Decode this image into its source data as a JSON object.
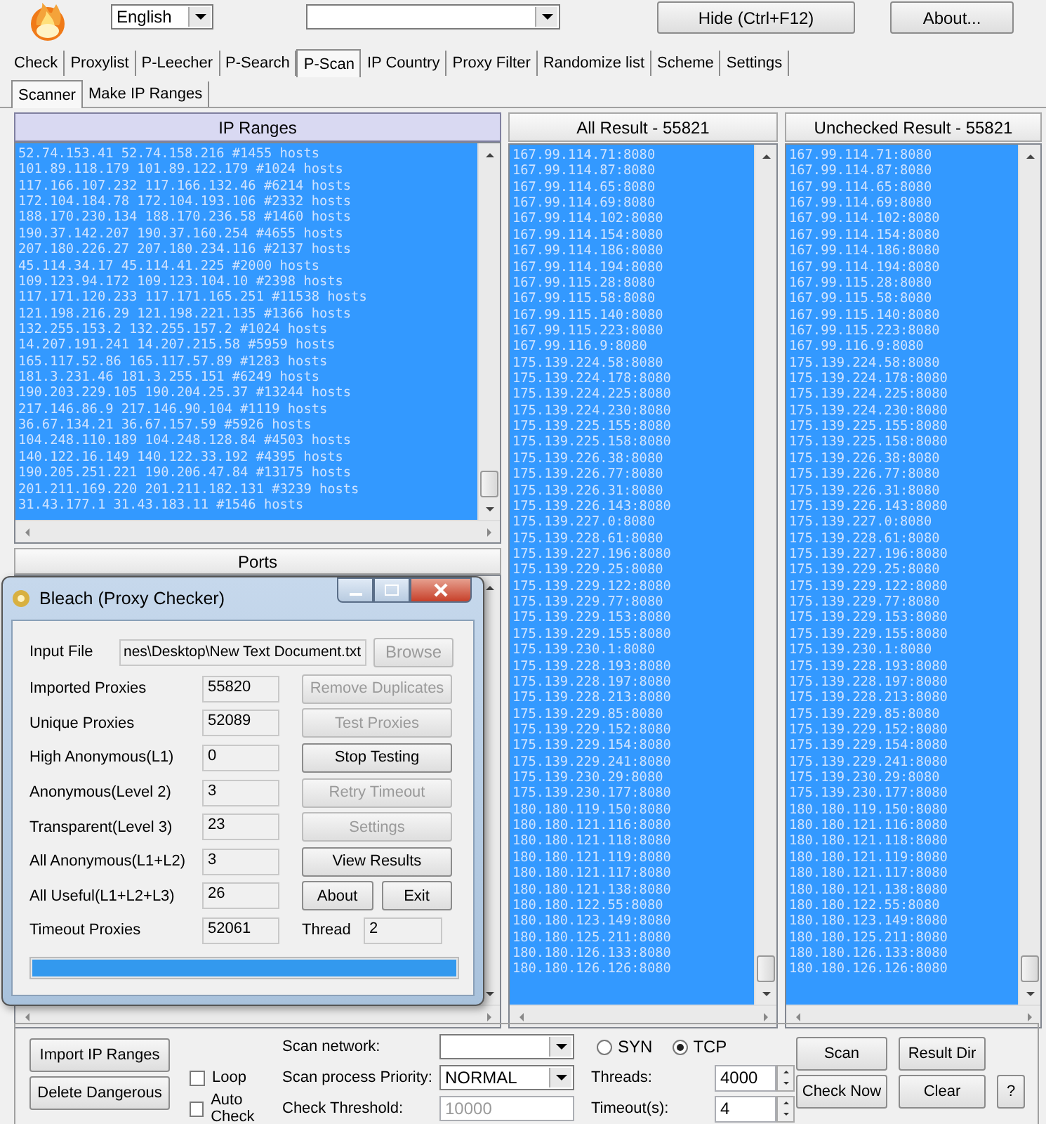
{
  "app": {
    "language": "English",
    "hide_button": "Hide (Ctrl+F12)",
    "about_button": "About..."
  },
  "tabs": [
    {
      "label": "Check",
      "selected": false
    },
    {
      "label": "Proxylist",
      "selected": false
    },
    {
      "label": "P-Leecher",
      "selected": false
    },
    {
      "label": "P-Search",
      "selected": false
    },
    {
      "label": "P-Scan",
      "selected": true
    },
    {
      "label": "IP Country",
      "selected": false
    },
    {
      "label": "Proxy Filter",
      "selected": false
    },
    {
      "label": "Randomize list",
      "selected": false
    },
    {
      "label": "Scheme",
      "selected": false
    },
    {
      "label": "Settings",
      "selected": false
    }
  ],
  "subtabs": [
    {
      "label": "Scanner",
      "selected": true
    },
    {
      "label": "Make IP Ranges",
      "selected": false
    }
  ],
  "ip_ranges": {
    "header": "IP Ranges",
    "rows": [
      "52.74.153.41 52.74.158.216 #1455 hosts",
      "101.89.118.179 101.89.122.179 #1024 hosts",
      "117.166.107.232 117.166.132.46 #6214 hosts",
      "172.104.184.78 172.104.193.106 #2332 hosts",
      "188.170.230.134 188.170.236.58 #1460 hosts",
      "190.37.142.207 190.37.160.254 #4655 hosts",
      "207.180.226.27 207.180.234.116 #2137 hosts",
      "45.114.34.17 45.114.41.225 #2000 hosts",
      "109.123.94.172 109.123.104.10 #2398 hosts",
      "117.171.120.233 117.171.165.251 #11538 hosts",
      "121.198.216.29 121.198.221.135 #1366 hosts",
      "132.255.153.2 132.255.157.2 #1024 hosts",
      "14.207.191.241 14.207.215.58 #5959 hosts",
      "165.117.52.86 165.117.57.89 #1283 hosts",
      "181.3.231.46 181.3.255.151 #6249 hosts",
      "190.203.229.105 190.204.25.37 #13244 hosts",
      "217.146.86.9 217.146.90.104 #1119 hosts",
      "36.67.134.21 36.67.157.59 #5926 hosts",
      "104.248.110.189 104.248.128.84 #4503 hosts",
      "140.122.16.149 140.122.33.192 #4395 hosts",
      "190.205.251.221 190.206.47.84 #13175 hosts",
      "201.211.169.220 201.211.182.131 #3239 hosts",
      "31.43.177.1 31.43.183.11 #1546 hosts"
    ]
  },
  "ports": {
    "header": "Ports"
  },
  "all_result": {
    "header": "All Result - 55821",
    "rows": [
      "167.99.114.71:8080",
      "167.99.114.87:8080",
      "167.99.114.65:8080",
      "167.99.114.69:8080",
      "167.99.114.102:8080",
      "167.99.114.154:8080",
      "167.99.114.186:8080",
      "167.99.114.194:8080",
      "167.99.115.28:8080",
      "167.99.115.58:8080",
      "167.99.115.140:8080",
      "167.99.115.223:8080",
      "167.99.116.9:8080",
      "175.139.224.58:8080",
      "175.139.224.178:8080",
      "175.139.224.225:8080",
      "175.139.224.230:8080",
      "175.139.225.155:8080",
      "175.139.225.158:8080",
      "175.139.226.38:8080",
      "175.139.226.77:8080",
      "175.139.226.31:8080",
      "175.139.226.143:8080",
      "175.139.227.0:8080",
      "175.139.228.61:8080",
      "175.139.227.196:8080",
      "175.139.229.25:8080",
      "175.139.229.122:8080",
      "175.139.229.77:8080",
      "175.139.229.153:8080",
      "175.139.229.155:8080",
      "175.139.230.1:8080",
      "175.139.228.193:8080",
      "175.139.228.197:8080",
      "175.139.228.213:8080",
      "175.139.229.85:8080",
      "175.139.229.152:8080",
      "175.139.229.154:8080",
      "175.139.229.241:8080",
      "175.139.230.29:8080",
      "175.139.230.177:8080",
      "180.180.119.150:8080",
      "180.180.121.116:8080",
      "180.180.121.118:8080",
      "180.180.121.119:8080",
      "180.180.121.117:8080",
      "180.180.121.138:8080",
      "180.180.122.55:8080",
      "180.180.123.149:8080",
      "180.180.125.211:8080",
      "180.180.126.133:8080",
      "180.180.126.126:8080"
    ]
  },
  "unchecked_result": {
    "header": "Unchecked Result - 55821",
    "rows": [
      "167.99.114.71:8080",
      "167.99.114.87:8080",
      "167.99.114.65:8080",
      "167.99.114.69:8080",
      "167.99.114.102:8080",
      "167.99.114.154:8080",
      "167.99.114.186:8080",
      "167.99.114.194:8080",
      "167.99.115.28:8080",
      "167.99.115.58:8080",
      "167.99.115.140:8080",
      "167.99.115.223:8080",
      "167.99.116.9:8080",
      "175.139.224.58:8080",
      "175.139.224.178:8080",
      "175.139.224.225:8080",
      "175.139.224.230:8080",
      "175.139.225.155:8080",
      "175.139.225.158:8080",
      "175.139.226.38:8080",
      "175.139.226.77:8080",
      "175.139.226.31:8080",
      "175.139.226.143:8080",
      "175.139.227.0:8080",
      "175.139.228.61:8080",
      "175.139.227.196:8080",
      "175.139.229.25:8080",
      "175.139.229.122:8080",
      "175.139.229.77:8080",
      "175.139.229.153:8080",
      "175.139.229.155:8080",
      "175.139.230.1:8080",
      "175.139.228.193:8080",
      "175.139.228.197:8080",
      "175.139.228.213:8080",
      "175.139.229.85:8080",
      "175.139.229.152:8080",
      "175.139.229.154:8080",
      "175.139.229.241:8080",
      "175.139.230.29:8080",
      "175.139.230.177:8080",
      "180.180.119.150:8080",
      "180.180.121.116:8080",
      "180.180.121.118:8080",
      "180.180.121.119:8080",
      "180.180.121.117:8080",
      "180.180.121.138:8080",
      "180.180.122.55:8080",
      "180.180.123.149:8080",
      "180.180.125.211:8080",
      "180.180.126.133:8080",
      "180.180.126.126:8080"
    ]
  },
  "checker_dialog": {
    "title": "Bleach (Proxy Checker)",
    "input_file": {
      "label": "Input File",
      "value": "nes\\Desktop\\New Text Document.txt"
    },
    "browse": {
      "label": "Browse",
      "disabled": true
    },
    "rows": [
      {
        "label": "Imported Proxies",
        "value": "55820",
        "actions": [
          {
            "label": "Remove Duplicates",
            "disabled": true
          }
        ]
      },
      {
        "label": "Unique Proxies",
        "value": "52089",
        "actions": [
          {
            "label": "Test Proxies",
            "disabled": true
          }
        ]
      },
      {
        "label": "High Anonymous(L1)",
        "value": "0",
        "actions": [
          {
            "label": "Stop Testing",
            "disabled": false
          }
        ]
      },
      {
        "label": "Anonymous(Level 2)",
        "value": "3",
        "actions": [
          {
            "label": "Retry Timeout",
            "disabled": true
          }
        ]
      },
      {
        "label": "Transparent(Level 3)",
        "value": "23",
        "actions": [
          {
            "label": "Settings",
            "disabled": true
          }
        ]
      },
      {
        "label": "All Anonymous(L1+L2)",
        "value": "3",
        "actions": [
          {
            "label": "View Results",
            "disabled": false
          }
        ]
      },
      {
        "label": "All Useful(L1+L2+L3)",
        "value": "26",
        "actions": [
          {
            "label": "About",
            "disabled": false
          },
          {
            "label": "Exit",
            "disabled": false
          }
        ]
      },
      {
        "label": "Timeout Proxies",
        "value": "52061",
        "thread": {
          "label": "Thread",
          "value": "2"
        }
      }
    ],
    "progress": {
      "level": 1
    }
  },
  "scan_panel": {
    "left_buttons": [
      "Import IP Ranges",
      "Delete Dangerous"
    ],
    "checks": [
      {
        "label": "Loop",
        "checked": false
      },
      {
        "label": "Auto Check",
        "checked": false
      }
    ],
    "scan_network": {
      "label": "Scan network:"
    },
    "priority": {
      "label": "Scan process Priority:",
      "value": "NORMAL"
    },
    "threshold": {
      "label": "Check Threshold:",
      "value": "10000",
      "disabled": true
    },
    "protocols": [
      {
        "label": "SYN",
        "selected": false
      },
      {
        "label": "TCP",
        "selected": true
      }
    ],
    "threads": {
      "label": "Threads:",
      "value": "4000"
    },
    "timeout": {
      "label": "Timeout(s):",
      "value": "4"
    },
    "buttons": [
      "Scan",
      "Result Dir",
      "Check Now",
      "Clear",
      "?"
    ]
  }
}
